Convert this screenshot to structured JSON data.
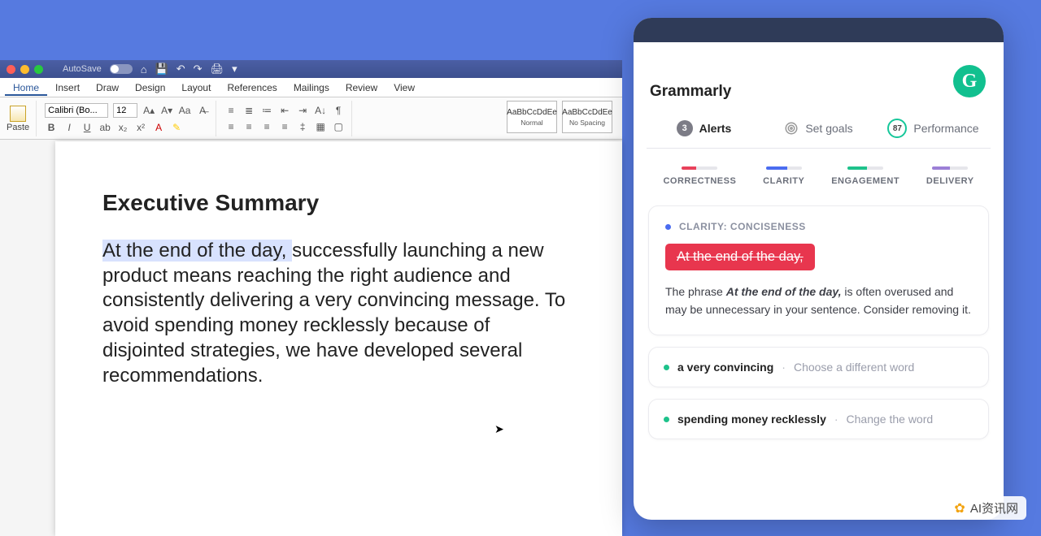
{
  "word": {
    "autosave": "AutoSave",
    "menu": [
      "Home",
      "Insert",
      "Draw",
      "Design",
      "Layout",
      "References",
      "Mailings",
      "Review",
      "View"
    ],
    "active_menu": "Home",
    "font": {
      "name": "Calibri (Bo...",
      "size": "12"
    },
    "paste": "Paste",
    "styles": [
      {
        "sample": "AaBbCcDdEe",
        "name": "Normal"
      },
      {
        "sample": "AaBbCcDdEe",
        "name": "No Spacing"
      }
    ],
    "doc": {
      "title": "Executive Summary",
      "highlight": "At the end of the day, ",
      "body_rest": "successfully launching a new product means reaching the right audience and consistently delivering a very convincing message. To avoid spending money recklessly because of disjointed strategies, we have developed several recommendations."
    }
  },
  "panel": {
    "title": "Grammarly",
    "tabs": {
      "alerts": {
        "label": "Alerts",
        "count": "3"
      },
      "goals": {
        "label": "Set goals"
      },
      "perf": {
        "label": "Performance",
        "score": "87"
      }
    },
    "categories": [
      "CORRECTNESS",
      "CLARITY",
      "ENGAGEMENT",
      "DELIVERY"
    ],
    "issue": {
      "tag": "CLARITY: CONCISENESS",
      "chip": "At the end of the day,",
      "explain_pre": "The phrase ",
      "explain_bold": "At the end of the day,",
      "explain_post": " is often overused and may be unnecessary in your sentence. Consider removing it."
    },
    "mini": [
      {
        "phrase": "a very convincing",
        "hint": "Choose a different word"
      },
      {
        "phrase": "spending money recklessly",
        "hint": "Change the word"
      }
    ]
  },
  "watermark": "AI资讯网"
}
